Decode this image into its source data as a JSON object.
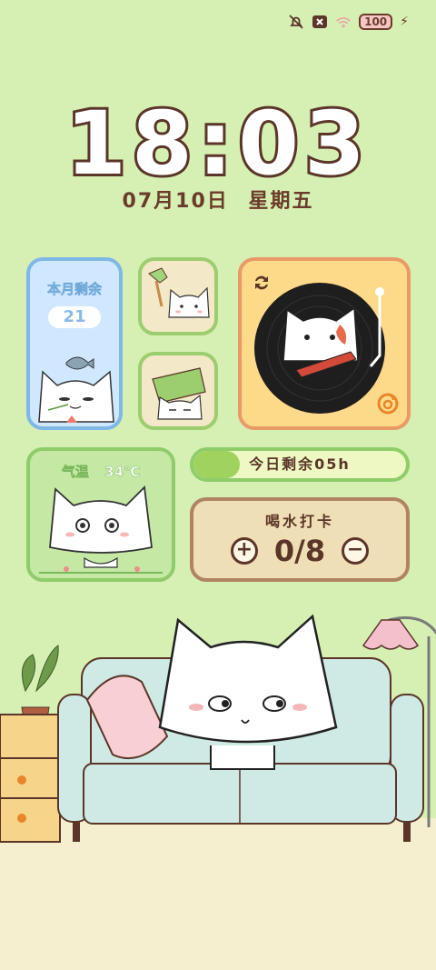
{
  "status": {
    "battery": "100"
  },
  "clock": {
    "time": "18:03",
    "date": "07月10日",
    "weekday": "星期五"
  },
  "month_widget": {
    "label": "本月剩余",
    "value": "21"
  },
  "weather_widget": {
    "label": "气温",
    "temperature": "34℃"
  },
  "day_progress": {
    "text": "今日剩余05h",
    "fill_fraction": 0.22
  },
  "water_widget": {
    "title": "喝水打卡",
    "count": "0/8",
    "plus": "+",
    "minus": "−"
  },
  "icons": [
    "mute-icon",
    "close-badge-icon",
    "wifi-icon",
    "battery-icon",
    "charging-icon",
    "refresh-icon",
    "music-app-icon"
  ],
  "colors": {
    "background": "#d6f0b4",
    "text_brown": "#5a3528",
    "month_blue": "#7fb8e6",
    "vinyl_orange": "#e99a66",
    "progress_green": "#9fd35e"
  }
}
